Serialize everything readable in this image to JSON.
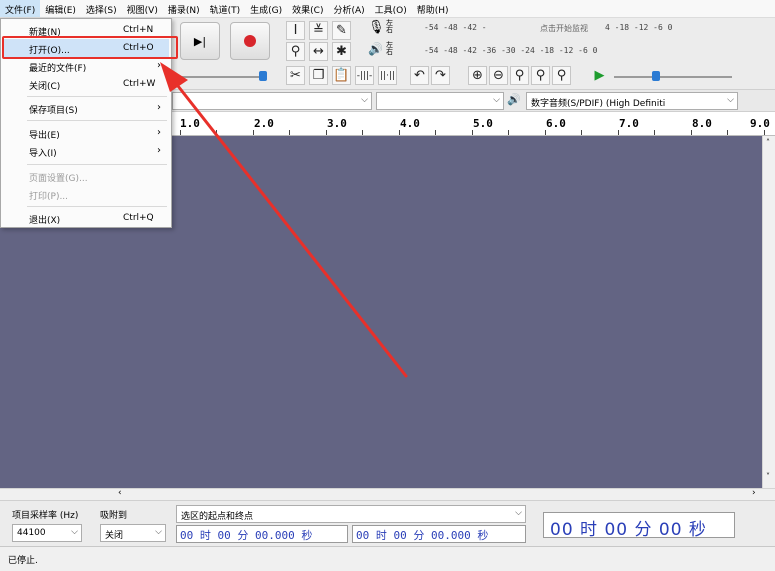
{
  "menubar": {
    "items": [
      "文件(F)",
      "编辑(E)",
      "选择(S)",
      "视图(V)",
      "播录(N)",
      "轨道(T)",
      "生成(G)",
      "效果(C)",
      "分析(A)",
      "工具(O)",
      "帮助(H)"
    ]
  },
  "file_menu": {
    "items": [
      {
        "label": "新建(N)",
        "shortcut": "Ctrl+N"
      },
      {
        "label": "打开(O)...",
        "shortcut": "Ctrl+O"
      },
      {
        "label": "最近的文件(F)",
        "submenu": "›"
      },
      {
        "label": "关闭(C)",
        "shortcut": "Ctrl+W"
      },
      {
        "label": "保存项目(S)",
        "submenu": "›"
      },
      {
        "label": "导出(E)",
        "submenu": "›"
      },
      {
        "label": "导入(I)",
        "submenu": "›"
      },
      {
        "label": "页面设置(G)..."
      },
      {
        "label": "打印(P)..."
      },
      {
        "label": "退出(X)",
        "shortcut": "Ctrl+Q"
      }
    ]
  },
  "meters": {
    "rec_scale": "-54   -48   -42   -",
    "rec_hint": "点击开始监视",
    "rec_scale_tail": "4   -18   -12   -6   0",
    "play_scale": "-54   -48   -42   -36   -30   -24   -18   -12   -6   0",
    "lr_top": "左右",
    "lr_bottom": "左右"
  },
  "device": {
    "output": "数字音频(S/PDIF) (High Definiti"
  },
  "ruler": {
    "ticks": [
      "1.0",
      "2.0",
      "3.0",
      "4.0",
      "5.0",
      "6.0",
      "7.0",
      "8.0",
      "9.0"
    ]
  },
  "selection_toolbar": {
    "rate_label": "项目采样率 (Hz)",
    "snap_label": "吸附到",
    "rate_value": "44100",
    "snap_value": "关闭",
    "sel_mode": "选区的起点和终点",
    "start_time": "00 时 00 分 00.000 秒",
    "end_time": "00 时 00 分 00.000 秒",
    "big_time": "00 时 00 分 00 秒"
  },
  "status": {
    "text": "已停止."
  },
  "colors": {
    "track_bg": "#636483",
    "annotation_red": "#e8302a",
    "time_blue": "#2a3fb8"
  }
}
